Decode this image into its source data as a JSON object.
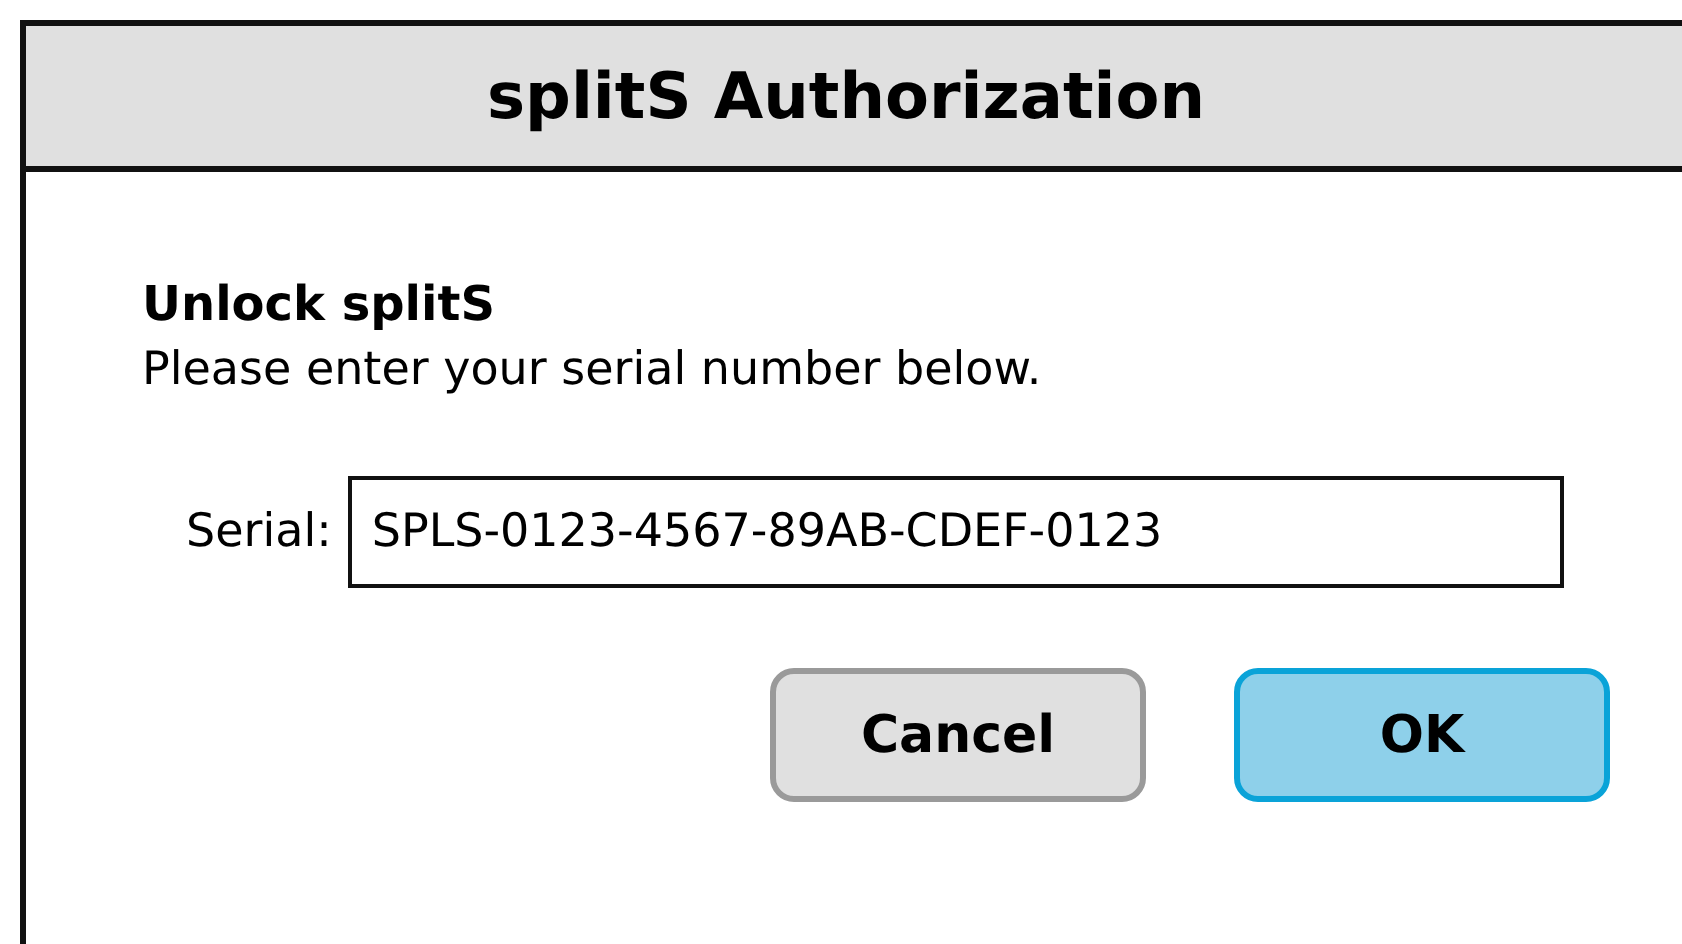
{
  "window": {
    "title": "splitS Authorization"
  },
  "heading": "Unlock splitS",
  "message": "Please enter your serial number below.",
  "serial_field": {
    "label": "Serial:",
    "value": "SPLS-0123-4567-89AB-CDEF-0123"
  },
  "buttons": [
    {
      "label": "Cancel",
      "kind": "secondary"
    },
    {
      "label": "OK",
      "kind": "primary"
    }
  ]
}
